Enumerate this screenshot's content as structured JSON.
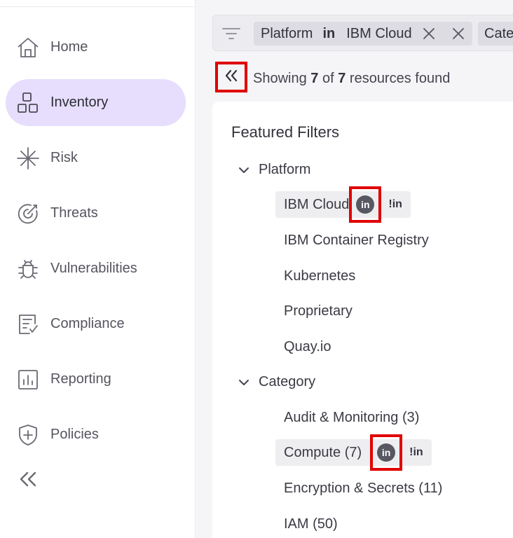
{
  "sidebar": {
    "items": [
      {
        "label": "Home",
        "icon": "home-icon"
      },
      {
        "label": "Inventory",
        "icon": "inventory-icon",
        "active": true
      },
      {
        "label": "Risk",
        "icon": "risk-icon"
      },
      {
        "label": "Threats",
        "icon": "threats-icon"
      },
      {
        "label": "Vulnerabilities",
        "icon": "vulnerabilities-icon"
      },
      {
        "label": "Compliance",
        "icon": "compliance-icon"
      },
      {
        "label": "Reporting",
        "icon": "reporting-icon"
      },
      {
        "label": "Policies",
        "icon": "policies-icon"
      }
    ],
    "collapse_icon": "double-chevron-left-icon",
    "active_color": "#e6defc"
  },
  "filterbar": {
    "chips": [
      {
        "key": "Platform",
        "operator": "in",
        "value": "IBM Cloud"
      },
      {
        "key": "Cate"
      }
    ]
  },
  "results": {
    "prefix": "Showing",
    "shown": "7",
    "of": "of",
    "total": "7",
    "suffix": "resources found"
  },
  "panel": {
    "title": "Featured Filters",
    "groups": [
      {
        "label": "Platform",
        "options": [
          "IBM Cloud",
          "IBM Container Registry",
          "Kubernetes",
          "Proprietary",
          "Quay.io"
        ]
      },
      {
        "label": "Category",
        "options": [
          "Audit & Monitoring (3)",
          "Compute (7)",
          "Encryption & Secrets (11)",
          "IAM (50)"
        ]
      }
    ],
    "in_label": "in",
    "notin_label": "!in"
  },
  "colors": {
    "highlight_box": "#e00000",
    "badge": "#585862"
  }
}
